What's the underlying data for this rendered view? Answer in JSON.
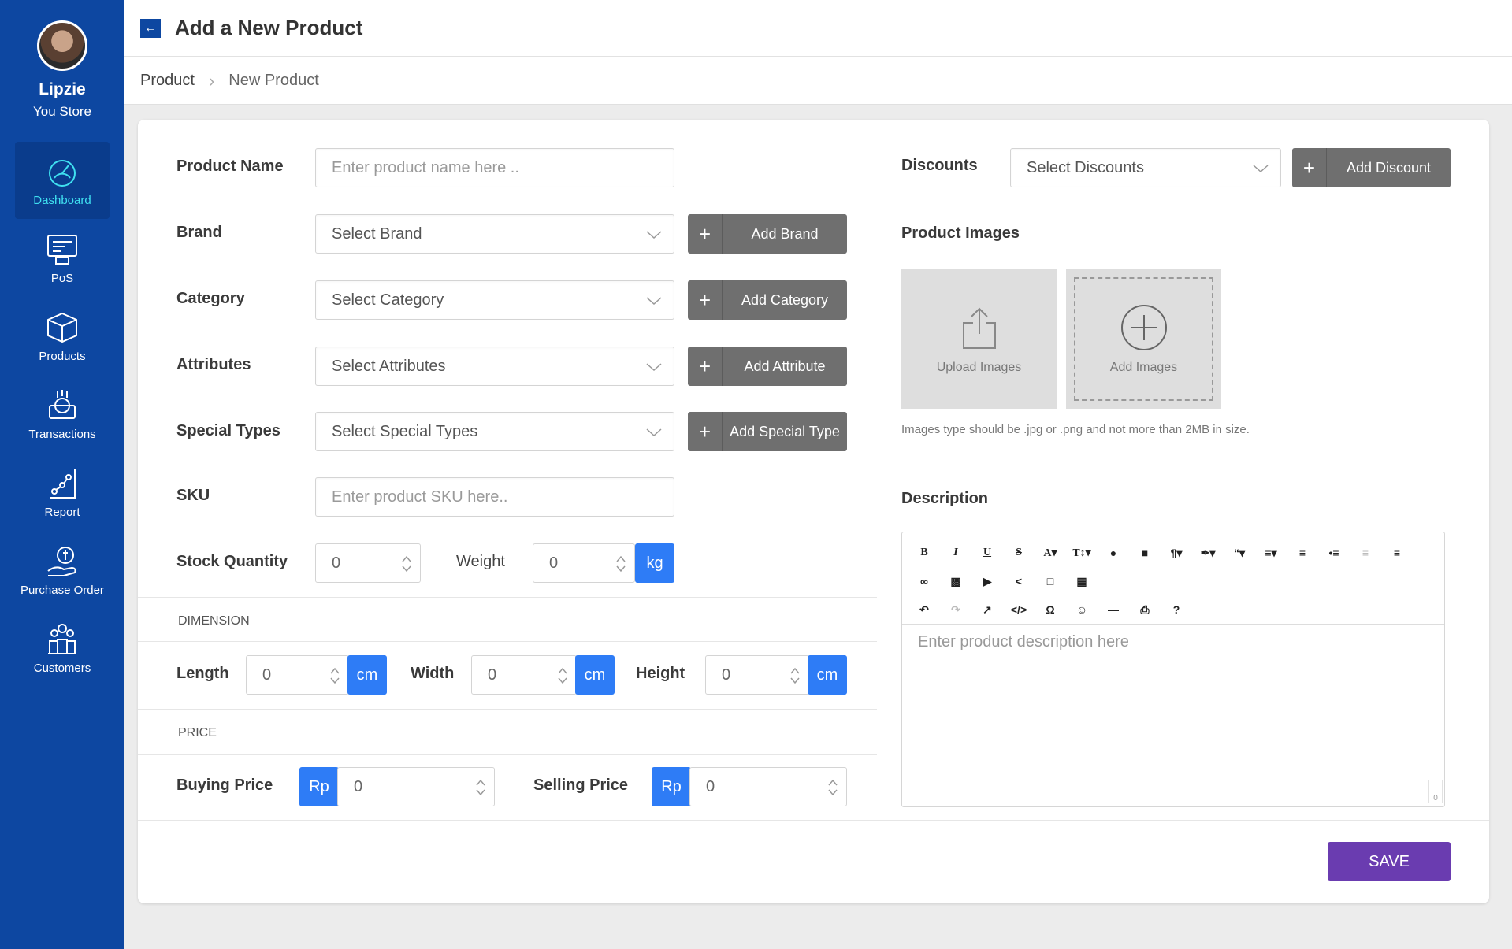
{
  "user": {
    "name": "Lipzie",
    "store": "You Store"
  },
  "nav": [
    {
      "label": "Dashboard",
      "icon": "dashboard-icon",
      "active": true
    },
    {
      "label": "PoS",
      "icon": "pos-icon"
    },
    {
      "label": "Products",
      "icon": "box-icon"
    },
    {
      "label": "Transactions",
      "icon": "transactions-icon"
    },
    {
      "label": "Report",
      "icon": "report-icon"
    },
    {
      "label": "Purchase Order",
      "icon": "purchase-order-icon"
    },
    {
      "label": "Customers",
      "icon": "customers-icon"
    }
  ],
  "header": {
    "title": "Add a New Product"
  },
  "breadcrumb": {
    "item1": "Product",
    "item2": "New Product"
  },
  "form": {
    "product_name": {
      "label": "Product Name",
      "placeholder": "Enter product name here .."
    },
    "brand": {
      "label": "Brand",
      "value": "Select Brand",
      "button": "Add Brand"
    },
    "category": {
      "label": "Category",
      "value": "Select Category",
      "button": "Add Category"
    },
    "attributes": {
      "label": "Attributes",
      "value": "Select Attributes",
      "button": "Add Attribute"
    },
    "special_types": {
      "label": "Special Types",
      "value": "Select Special Types",
      "button": "Add Special Type"
    },
    "sku": {
      "label": "SKU",
      "placeholder": "Enter product SKU here.."
    },
    "stock_quantity": {
      "label": "Stock Quantity",
      "value": "0"
    },
    "weight": {
      "label": "Weight",
      "value": "0",
      "unit": "kg"
    },
    "dimension": {
      "section": "DIMENSION",
      "length": {
        "label": "Length",
        "value": "0",
        "unit": "cm"
      },
      "width": {
        "label": "Width",
        "value": "0",
        "unit": "cm"
      },
      "height": {
        "label": "Height",
        "value": "0",
        "unit": "cm"
      }
    },
    "price": {
      "section": "PRICE",
      "buying": {
        "label": "Buying Price",
        "currency": "Rp",
        "value": "0"
      },
      "selling": {
        "label": "Selling Price",
        "currency": "Rp",
        "value": "0"
      }
    },
    "discounts": {
      "label": "Discounts",
      "value": "Select Discounts",
      "button": "Add Discount"
    },
    "images": {
      "label": "Product Images",
      "upload": "Upload Images",
      "add": "Add Images",
      "hint": "Images type should be .jpg or .png and not more than 2MB in size."
    },
    "description": {
      "label": "Description",
      "placeholder": "Enter product description here",
      "char_count": "0"
    },
    "save": "SAVE"
  },
  "colors": {
    "sidebar": "#0d47a1",
    "accent": "#2e7cf6",
    "save": "#6a3cb0",
    "grey_button": "#6f6f6f"
  }
}
